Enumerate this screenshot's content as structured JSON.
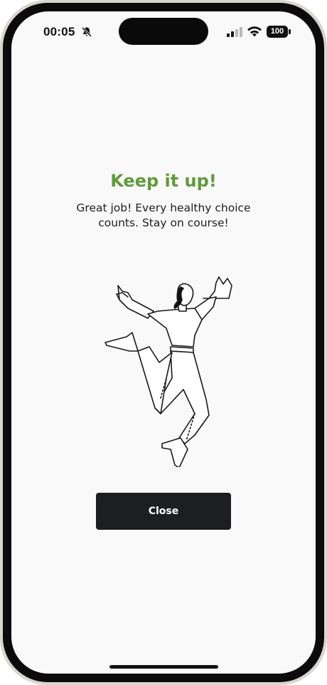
{
  "status_bar": {
    "time": "00:05",
    "silent_icon": "bell-slash-icon",
    "signal_icon": "cellular-signal-icon",
    "wifi_icon": "wifi-icon",
    "battery_level": "100"
  },
  "card": {
    "title": "Keep it up!",
    "message": "Great job! Every healthy choice counts. Stay on course!",
    "illustration_icon": "jumping-woman-illustration",
    "title_color": "#5f9a3c"
  },
  "actions": {
    "close_label": "Close",
    "button_color": "#1d1e20"
  }
}
